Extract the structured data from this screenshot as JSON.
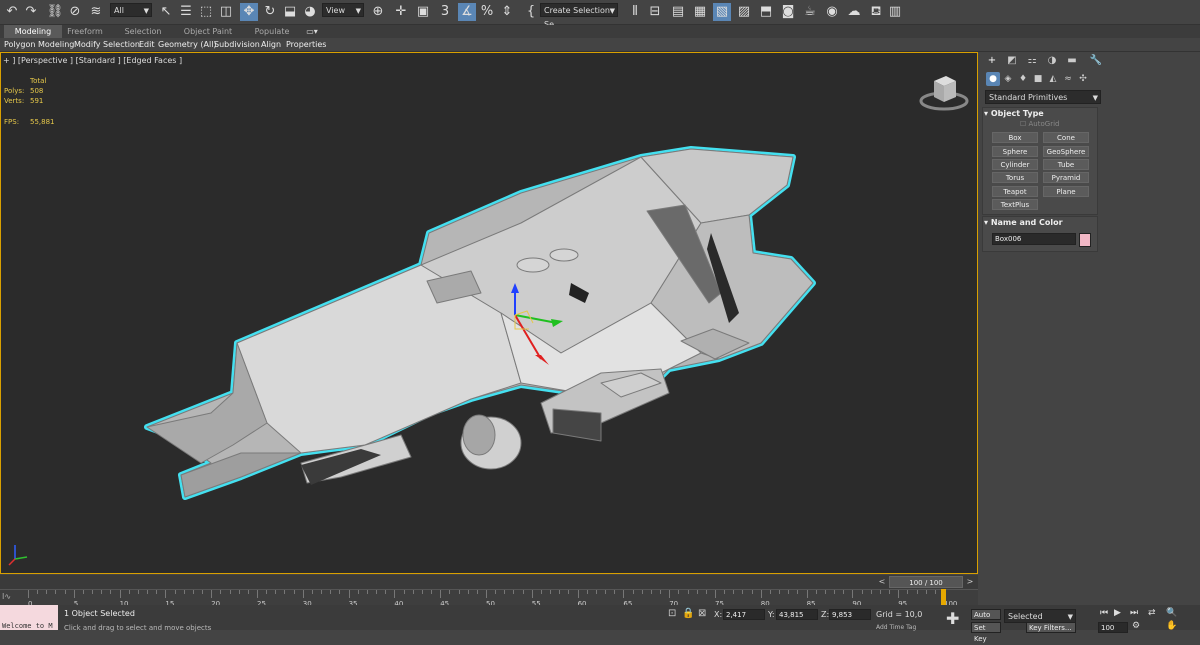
{
  "toolbar": {
    "filter_dropdown": "All",
    "view_dropdown": "View",
    "selection_set": "Create Selection Se",
    "snap_label": "3"
  },
  "ribbon": {
    "tabs": [
      "Modeling",
      "Freeform",
      "Selection",
      "Object Paint",
      "Populate"
    ],
    "active_tab": "Modeling",
    "subtabs": [
      "Polygon Modeling",
      "Modify Selection",
      "Edit",
      "Geometry (All)",
      "Subdivision",
      "Align",
      "Properties"
    ]
  },
  "viewport": {
    "label": "+ ] [Perspective ] [Standard ] [Edged Faces ]",
    "stats": {
      "header": "Total",
      "polys_label": "Polys:",
      "polys_value": "508",
      "verts_label": "Verts:",
      "verts_value": "591",
      "fps_label": "FPS:",
      "fps_value": "55,881"
    }
  },
  "command_panel": {
    "category_dropdown": "Standard Primitives",
    "object_type_title": "Object Type",
    "autogrid_label": "AutoGrid",
    "buttons": [
      "Box",
      "Cone",
      "Sphere",
      "GeoSphere",
      "Cylinder",
      "Tube",
      "Torus",
      "Pyramid",
      "Teapot",
      "Plane",
      "TextPlus"
    ],
    "name_color_title": "Name and Color",
    "object_name": "Box006",
    "object_color": "#f2b8c6"
  },
  "timeline": {
    "frame_display": "100 / 100",
    "ticks": [
      "0",
      "5",
      "10",
      "15",
      "20",
      "25",
      "30",
      "35",
      "40",
      "45",
      "50",
      "55",
      "60",
      "65",
      "70",
      "75",
      "80",
      "85",
      "90",
      "95",
      "100"
    ]
  },
  "status": {
    "maxscript": "Welcome to M",
    "selection_status": "1 Object Selected",
    "prompt": "Click and drag to select and move objects",
    "x_label": "X:",
    "x_value": "2,417",
    "y_label": "Y:",
    "y_value": "43,815",
    "z_label": "Z:",
    "z_value": "9,853",
    "grid": "Grid = 10,0",
    "add_time_tag": "Add Time Tag",
    "auto_key": "Auto Key",
    "set_key": "Set Key",
    "key_mode": "Selected",
    "key_filters": "Key Filters...",
    "frame": "100"
  },
  "colors": {
    "selection_outline": "#44e0f0",
    "viewport_border": "#d9a000",
    "stat_text": "#e6c84a",
    "active_blue": "#5a86b5"
  }
}
